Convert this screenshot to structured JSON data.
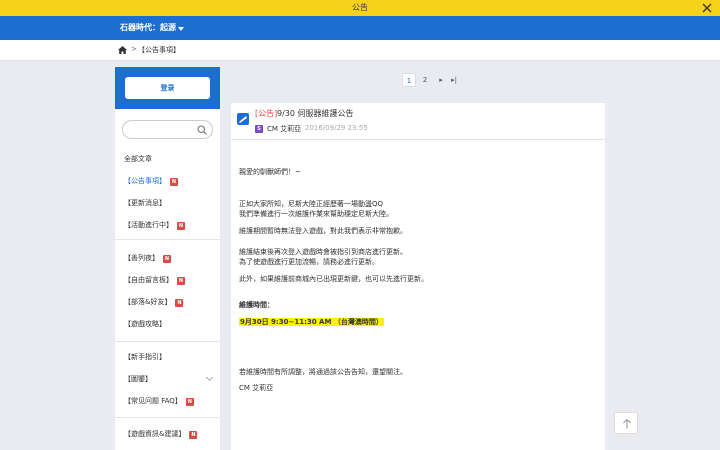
{
  "window": {
    "title": "公告"
  },
  "header": {
    "game_name": "石器時代：起源"
  },
  "breadcrumb": {
    "current": "【公告事項】"
  },
  "sidebar": {
    "login_label": "登录",
    "search_placeholder": "",
    "items": [
      {
        "label": "全部文章",
        "badge": ""
      },
      {
        "label": "【公告事項】",
        "badge": "N"
      },
      {
        "label": "【更新消息】",
        "badge": ""
      },
      {
        "label": "【活動進行中】",
        "badge": "N"
      },
      {
        "label": "【善列夜】",
        "badge": "N"
      },
      {
        "label": "【自由留言板】",
        "badge": "N"
      },
      {
        "label": "【部落&好友】",
        "badge": "N"
      },
      {
        "label": "【遊戲攻略】",
        "badge": ""
      },
      {
        "label": "【新手指引】",
        "badge": ""
      },
      {
        "label": "【圖鑒】",
        "badge": ""
      },
      {
        "label": "【常见问题 FAQ】",
        "badge": "N"
      },
      {
        "label": "【遊戲資訊&建議】",
        "badge": "N"
      }
    ]
  },
  "pagination": {
    "pages": [
      "1",
      "2"
    ],
    "current": "1",
    "next": "▸",
    "last": "▸|"
  },
  "article": {
    "tag": "[公告]",
    "title": "9/30 伺服器維護公告",
    "author_badge": "S",
    "author": "CM 艾莉亞",
    "date": "2016/09/29 23:55",
    "lines": [
      "親愛的馴獸師們！~",
      "正如大家所知，尼斯大陸正經歷著一場動盪QQ",
      "我們準備進行一次維護作業來幫助穩定尼斯大陸。",
      "維護期間暫時無法登入遊戲，對此我們表示非常抱歉。",
      "維護結束後再次登入遊戲時會被指引到商店進行更新。",
      "為了使遊戲進行更加流暢，請務必進行更新。",
      "此外，如果維護前商城內已出現更新鍵，也可以先進行更新。",
      "維護時間：",
      "9月30日 9:30~11:30 AM （台灣澳時間）",
      "若維護時間有所調整，將通過該公告告知，還望關注。",
      "CM 艾莉亞"
    ]
  },
  "colors": {
    "accent": "#1c6fd0",
    "titlebar": "#f7d21d",
    "badge": "#e04848",
    "highlight": "#fff200"
  }
}
